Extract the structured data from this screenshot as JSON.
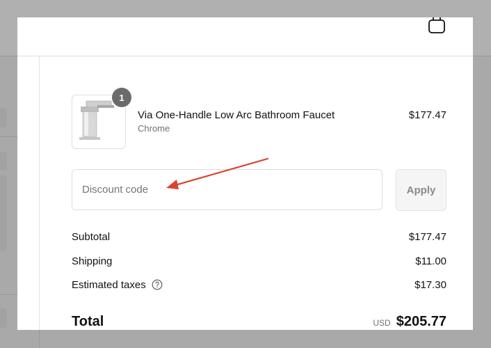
{
  "cart": {
    "item": {
      "title": "Via One-Handle Low Arc Bathroom Faucet",
      "variant": "Chrome",
      "price": "$177.47",
      "quantity": "1",
      "image": "faucet-image"
    }
  },
  "discount": {
    "placeholder": "Discount code",
    "apply_label": "Apply"
  },
  "summary": {
    "subtotal_label": "Subtotal",
    "subtotal_value": "$177.47",
    "shipping_label": "Shipping",
    "shipping_value": "$11.00",
    "taxes_label": "Estimated taxes",
    "taxes_value": "$17.30",
    "total_label": "Total",
    "currency": "USD",
    "total_value": "$205.77"
  },
  "icons": {
    "cart": "shopping-bag-icon",
    "help": "question-circle-icon"
  },
  "colors": {
    "annotation_arrow": "#d9452f",
    "badge": "#6b6b6b"
  }
}
